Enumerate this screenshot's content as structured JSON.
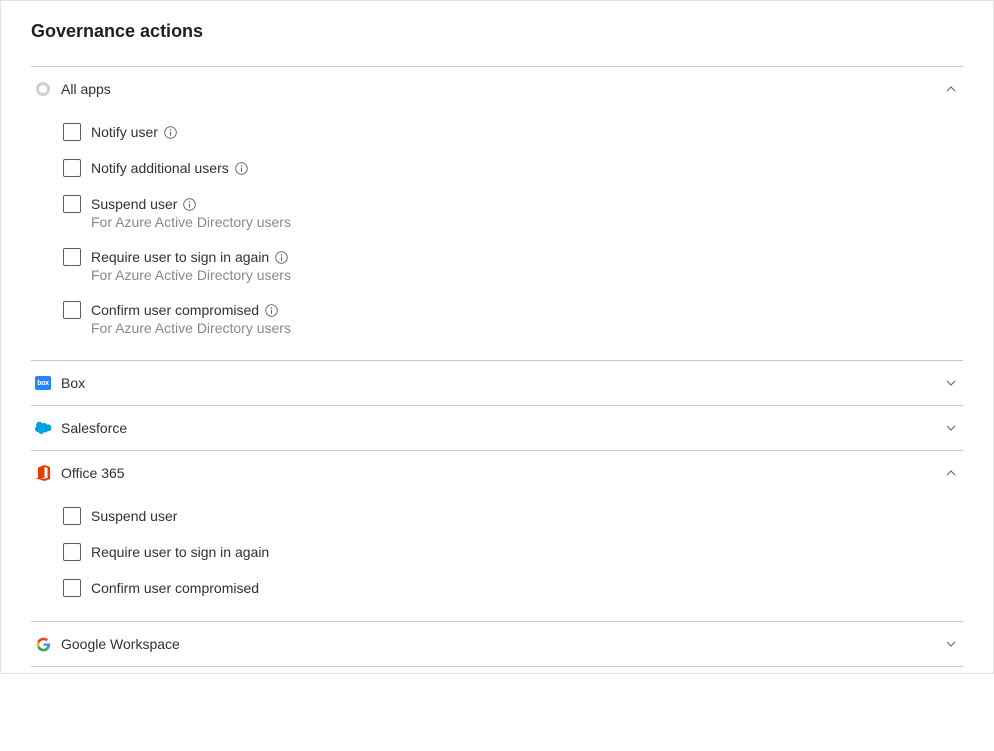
{
  "page_title": "Governance actions",
  "sections": [
    {
      "id": "all-apps",
      "label": "All apps",
      "expanded": true,
      "options": [
        {
          "label": "Notify user",
          "info": true,
          "subtitle": null
        },
        {
          "label": "Notify additional users",
          "info": true,
          "subtitle": null
        },
        {
          "label": "Suspend user",
          "info": true,
          "subtitle": "For Azure Active Directory users"
        },
        {
          "label": "Require user to sign in again",
          "info": true,
          "subtitle": "For Azure Active Directory users"
        },
        {
          "label": "Confirm user compromised",
          "info": true,
          "subtitle": "For Azure Active Directory users"
        }
      ]
    },
    {
      "id": "box",
      "label": "Box",
      "expanded": false
    },
    {
      "id": "salesforce",
      "label": "Salesforce",
      "expanded": false
    },
    {
      "id": "office-365",
      "label": "Office 365",
      "expanded": true,
      "options": [
        {
          "label": "Suspend user",
          "info": false,
          "subtitle": null
        },
        {
          "label": "Require user to sign in again",
          "info": false,
          "subtitle": null
        },
        {
          "label": "Confirm user compromised",
          "info": false,
          "subtitle": null
        }
      ]
    },
    {
      "id": "google-workspace",
      "label": "Google Workspace",
      "expanded": false
    }
  ]
}
